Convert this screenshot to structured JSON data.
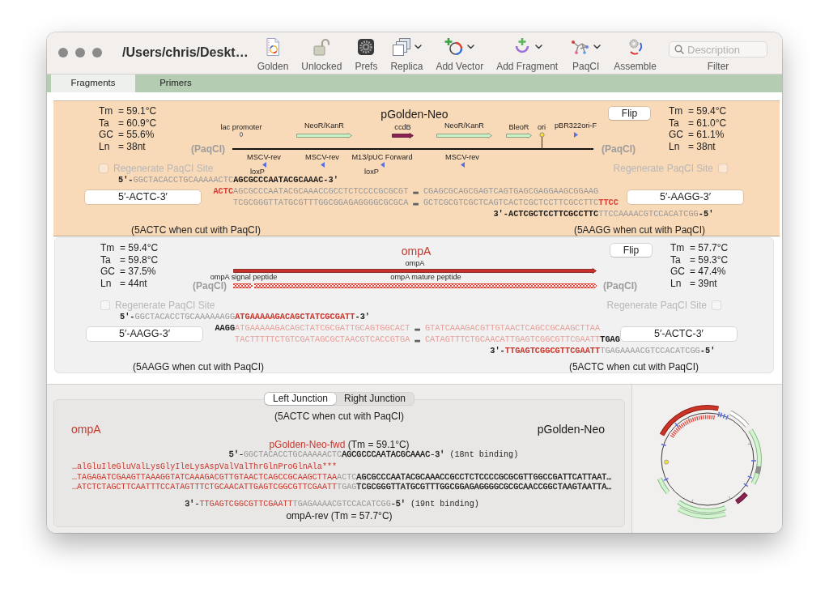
{
  "window": {
    "title": "/Users/chris/Deskt…"
  },
  "toolbar": [
    {
      "label": "Golden",
      "menu": false
    },
    {
      "label": "Unlocked",
      "menu": false
    },
    {
      "label": "Prefs",
      "menu": false
    },
    {
      "label": "Replica",
      "menu": true
    },
    {
      "label": "Add Vector",
      "menu": true
    },
    {
      "label": "Add Fragment",
      "menu": true
    },
    {
      "label": "PaqCI",
      "menu": true
    },
    {
      "label": "Assemble",
      "menu": false
    }
  ],
  "search": {
    "placeholder": "Description",
    "label": "Filter"
  },
  "tabs": [
    {
      "label": "Fragments",
      "selected": true
    },
    {
      "label": "Primers",
      "selected": false
    }
  ],
  "fragments": [
    {
      "name": "pGolden-Neo",
      "color": "#1a1a1a",
      "selected": true,
      "left_stats": [
        {
          "label": "Tm",
          "value": "= 59.1°C"
        },
        {
          "label": "Ta",
          "value": "= 60.9°C"
        },
        {
          "label": "GC",
          "value": "= 55.6%"
        },
        {
          "label": "Ln",
          "value": "= 38nt"
        }
      ],
      "right_stats": [
        {
          "label": "Tm",
          "value": "= 59.4°C"
        },
        {
          "label": "Ta",
          "value": "= 61.0°C"
        },
        {
          "label": "GC",
          "value": "= 61.1%"
        },
        {
          "label": "Ln",
          "value": "= 38nt"
        }
      ],
      "flip": "Flip",
      "map": {
        "sites": [
          "(PaqCI)",
          "(PaqCI)"
        ],
        "features": [
          {
            "label": "lac promoter",
            "kind": "promoter"
          },
          {
            "label": "NeoR/KanR",
            "kind": "gene",
            "color": "#c9f2c6"
          },
          {
            "label": "ccdB",
            "kind": "gene",
            "color": "#8b2252"
          },
          {
            "label": "NeoR/KanR",
            "kind": "gene",
            "color": "#c9f2c6"
          },
          {
            "label": "BleoR",
            "kind": "gene",
            "color": "#c9f2c6"
          },
          {
            "label": "ori",
            "kind": "origin"
          },
          {
            "label": "pBR322ori-F",
            "kind": "primer",
            "reverse": false
          },
          {
            "label": "MSCV-rev",
            "kind": "primer",
            "reverse": true
          },
          {
            "label": "MSCV-rev",
            "kind": "primer",
            "reverse": true
          },
          {
            "label": "M13/pUC Forward",
            "kind": "primer",
            "reverse": true
          },
          {
            "label": "MSCV-rev",
            "kind": "primer",
            "reverse": true
          },
          {
            "label": "loxP",
            "kind": "site"
          },
          {
            "label": "loxP",
            "kind": "site"
          }
        ]
      },
      "regenerate": [
        {
          "label": "Regenerate PaqCI Site",
          "checked": false,
          "disabled": true
        },
        {
          "label": "Regenerate PaqCI Site",
          "checked": false,
          "disabled": true
        }
      ],
      "overhangs": [
        "5′-ACTC-3′",
        "5′-AAGG-3′"
      ],
      "sequence_lines": [
        {
          "segments": [
            {
              "text": "5'-",
              "color": "#1a1a1a"
            },
            {
              "text": "GGCTACACCTGCAAAAACTC",
              "color": "#999999"
            },
            {
              "text": "AGCGCCCAATACGCAAAC-3'",
              "color": "#1a1a1a"
            }
          ]
        },
        {
          "segments": [
            {
              "text": "ACTC",
              "color": "#d23f35"
            },
            {
              "text": "AGCGCCCAATACGCAAACCGCCTCTCCCCGCGCGT",
              "color": "#999999"
            },
            {
              "text": " … ",
              "color": "#606060"
            },
            {
              "text": "CGAGCGCAGCGAGTCAGTGAGCGAGGAAGCGGAAG",
              "color": "#999999"
            }
          ]
        },
        {
          "segments": [
            {
              "text": "TCGCGGGTTATGCGTTTGGCGGAGAGGGGCGCGCA",
              "color": "#999999"
            },
            {
              "text": " … ",
              "color": "#606060"
            },
            {
              "text": "GCTCGCGTCGCTCAGTCACTCGCTCCTTCGCCTTC",
              "color": "#999999"
            },
            {
              "text": "TTCC",
              "color": "#d23f35"
            }
          ]
        },
        {
          "segments": [
            {
              "text": "3'-ACTCGCTCCTTCGCCTTC",
              "color": "#1a1a1a"
            },
            {
              "text": "TTCCAAAACGTCCACATCGG",
              "color": "#999999"
            },
            {
              "text": "-5'",
              "color": "#1a1a1a"
            }
          ]
        }
      ],
      "cut_notes": [
        "(5ACTC when cut with PaqCI)",
        "(5AAGG when cut with PaqCI)"
      ]
    },
    {
      "name": "ompA",
      "color": "#c8372d",
      "selected": false,
      "left_stats": [
        {
          "label": "Tm",
          "value": "= 59.4°C"
        },
        {
          "label": "Ta",
          "value": "= 59.8°C"
        },
        {
          "label": "GC",
          "value": "= 37.5%"
        },
        {
          "label": "Ln",
          "value": "= 44nt"
        }
      ],
      "right_stats": [
        {
          "label": "Tm",
          "value": "= 57.7°C"
        },
        {
          "label": "Ta",
          "value": "= 59.3°C"
        },
        {
          "label": "GC",
          "value": "= 47.4%"
        },
        {
          "label": "Ln",
          "value": "= 39nt"
        }
      ],
      "flip": "Flip",
      "map": {
        "sites": [
          "(PaqCI)",
          "(PaqCI)"
        ],
        "features": [
          {
            "label": "ompA",
            "kind": "gene",
            "color": "#c8302a"
          },
          {
            "label": "ompA signal peptide",
            "kind": "peptide",
            "color": "#e0463e"
          },
          {
            "label": "ompA mature peptide",
            "kind": "peptide",
            "color": "#e0463e"
          }
        ]
      },
      "regenerate": [
        {
          "label": "Regenerate PaqCI Site",
          "checked": false,
          "disabled": true
        },
        {
          "label": "Regenerate PaqCI Site",
          "checked": false,
          "disabled": true
        }
      ],
      "overhangs": [
        "5′-AAGG-3′",
        "5′-ACTC-3′"
      ],
      "sequence_lines": [
        {
          "segments": [
            {
              "text": "5'-",
              "color": "#1a1a1a"
            },
            {
              "text": "GGCTACACCTGCAAAAAAGG",
              "color": "#999999"
            },
            {
              "text": "ATGAAAAAGACAGCTATCGCGATT",
              "color": "#c8372d"
            },
            {
              "text": "-3'",
              "color": "#1a1a1a"
            }
          ]
        },
        {
          "segments": [
            {
              "text": "AAGG",
              "color": "#1a1a1a"
            },
            {
              "text": "ATGAAAAAGACAGCTATCGCGATTGCAGTGGCACT",
              "color": "#e6a09a"
            },
            {
              "text": " … ",
              "color": "#606060"
            },
            {
              "text": "GTATCAAAGACGTTGTAACTCAGCCGCAAGCTTAA",
              "color": "#e6a09a"
            }
          ]
        },
        {
          "segments": [
            {
              "text": "TACTTTTTCTGTCGATAGCGCTAACGTCACCGTGA",
              "color": "#e6a09a"
            },
            {
              "text": " … ",
              "color": "#606060"
            },
            {
              "text": "CATAGTTTCTGCAACATTGAGTCGGCGTTCGAATT",
              "color": "#e6a09a"
            },
            {
              "text": "TGAG",
              "color": "#1a1a1a"
            }
          ]
        },
        {
          "segments": [
            {
              "text": "3'-",
              "color": "#1a1a1a"
            },
            {
              "text": "TTGAGTCGGCGTTCGAATT",
              "color": "#c8372d"
            },
            {
              "text": "TGAGAAAACGTCCACATCGG",
              "color": "#999999"
            },
            {
              "text": "-5'",
              "color": "#1a1a1a"
            }
          ]
        }
      ],
      "cut_notes": [
        "(5AAGG when cut with PaqCI)",
        "(5ACTC when cut with PaqCI)"
      ]
    }
  ],
  "junction": {
    "tabs": [
      {
        "label": "Left Junction",
        "selected": true
      },
      {
        "label": "Right Junction",
        "selected": false
      }
    ],
    "cut_note": "(5ACTC when cut with PaqCI)",
    "fragments": [
      {
        "name": "ompA",
        "color": "#c8372d"
      },
      {
        "name": "pGolden-Neo",
        "color": "#1a1a1a"
      }
    ],
    "primers": [
      {
        "kind": "forward",
        "name": "pGolden-Neo-fwd",
        "color": "#c8372d",
        "tm": "(Tm = 59.1°C)",
        "segments": [
          {
            "text": "5'-",
            "color": "#1a1a1a"
          },
          {
            "text": "GGCTACACCTGCAAAAACTC",
            "color": "#969696"
          },
          {
            "text": "AGCGCCCAATACGCAAAC-3'",
            "color": "#1a1a1a"
          }
        ],
        "binding": "(18nt binding)"
      },
      {
        "kind": "reverse",
        "name": "ompA-rev",
        "color": "#1a1a1a",
        "tm": "(Tm = 57.7°C)",
        "segments": [
          {
            "text": "3'-",
            "color": "#1a1a1a"
          },
          {
            "text": "TTGAGTCGGCGTTCGAATT",
            "color": "#c8372d"
          },
          {
            "text": "TGAGAAAACGTCCACATCGG",
            "color": "#969696"
          },
          {
            "text": "-5'",
            "color": "#1a1a1a"
          }
        ],
        "binding": "(19nt binding)"
      }
    ],
    "sequence_lines": [
      {
        "segments": [
          {
            "text": "…alGluIleGluValLysGlyIleLysAspValValThrGlnProGlnAla***",
            "color": "#c8372d"
          }
        ]
      },
      {
        "segments": [
          {
            "text": "…TAGAGATCGAAGTTAAAGGTATCAAAGACGTTGTAACTCAGCCGCAAGCTTAA",
            "color": "#c8372d"
          },
          {
            "text": "ACTC",
            "color": "#969696"
          },
          {
            "text": "AGCGCCCAATACGCAAACCGCCTCTCCCCGCGCGTTGGCCGATTCATTAAT…",
            "color": "#1a1a1a"
          }
        ]
      },
      {
        "segments": [
          {
            "text": "…ATCTCTAGCTTCAATTTCCATAGTTTCTGCAACATTGAGTCGGCGTTCGAATT",
            "color": "#c8372d"
          },
          {
            "text": "TGAG",
            "color": "#969696"
          },
          {
            "text": "TCGCGGGTTATGCGTTTGGCGGAGAGGGGCGCGCAACCGGCTAAGTAATTA…",
            "color": "#1a1a1a"
          }
        ]
      }
    ]
  }
}
